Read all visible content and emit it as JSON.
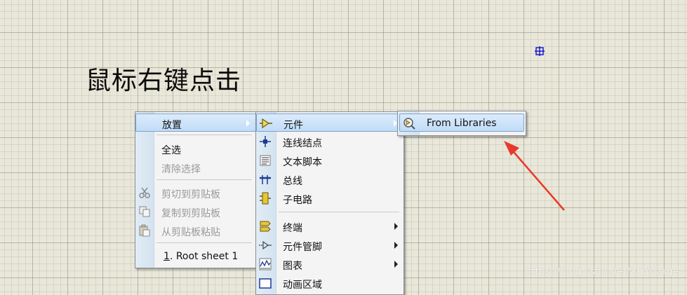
{
  "caption": "鼠标右键点击",
  "main_menu": {
    "items": [
      {
        "label": "放置",
        "has_submenu": true,
        "highlighted": true
      },
      {
        "label": "全选",
        "enabled": true
      },
      {
        "label": "清除选择",
        "enabled": false
      },
      {
        "label": "剪切到剪贴板",
        "enabled": false,
        "icon": "scissors-icon"
      },
      {
        "label": "复制到剪贴板",
        "enabled": false,
        "icon": "copy-icon"
      },
      {
        "label": "从剪贴板粘贴",
        "enabled": false,
        "icon": "paste-icon"
      }
    ],
    "sheet": {
      "number": "1",
      "rest": ". Root sheet 1"
    }
  },
  "place_menu": {
    "items": [
      {
        "label": "元件",
        "icon": "component-icon",
        "has_submenu": true,
        "highlighted": true
      },
      {
        "label": "连线结点",
        "icon": "junction-icon"
      },
      {
        "label": "文本脚本",
        "icon": "script-icon"
      },
      {
        "label": "总线",
        "icon": "bus-icon"
      },
      {
        "label": "子电路",
        "icon": "subcircuit-icon"
      },
      {
        "label": "终端",
        "icon": "terminal-icon",
        "has_submenu": true
      },
      {
        "label": "元件管脚",
        "icon": "pin-icon",
        "has_submenu": true
      },
      {
        "label": "图表",
        "icon": "graph-icon",
        "has_submenu": true
      },
      {
        "label": "动画区域",
        "icon": "animation-icon"
      }
    ]
  },
  "component_menu": {
    "items": [
      {
        "label": "From Libraries",
        "icon": "library-search-icon",
        "highlighted": true
      }
    ]
  },
  "watermark": "https://blog.csdn.net/ZHYCarge",
  "colors": {
    "canvas_bg": "#e9e7d9",
    "highlight": "#c1dcf7",
    "arrow": "#e8392c",
    "origin_marker": "#1a1ad0"
  }
}
